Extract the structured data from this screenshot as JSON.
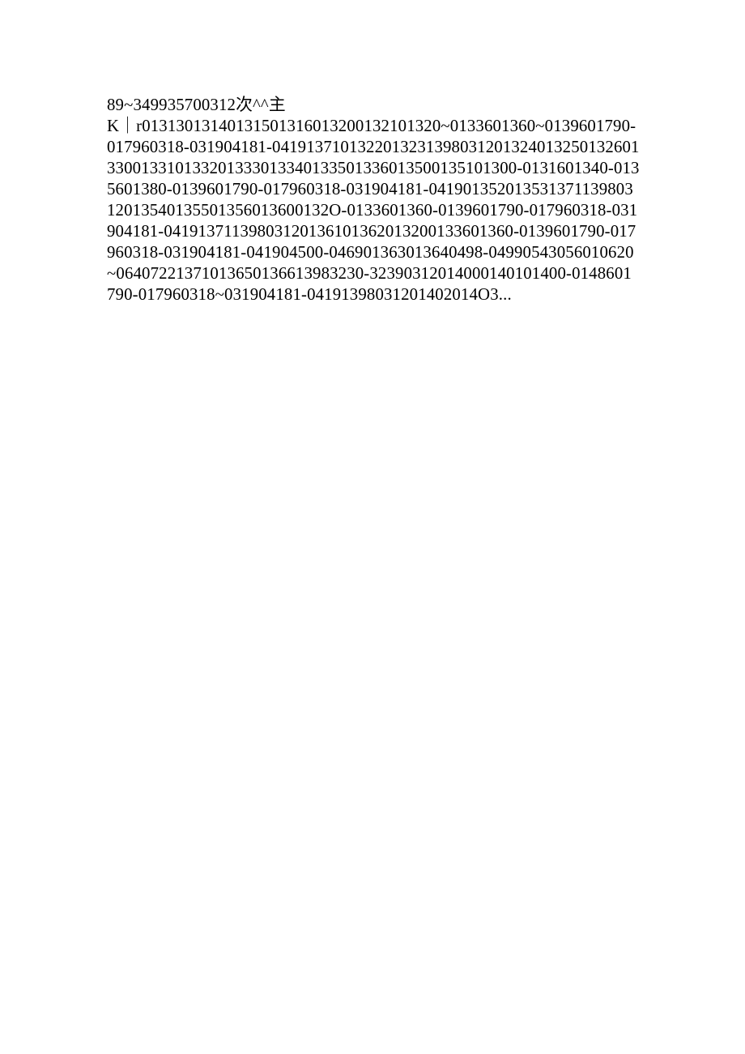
{
  "body_text": "89~349935700312次^^主\nK｜r01313013140131501316013200132101320~0133601360~0139601790-017960318-031904181-0419137101322013231398031201324013250132601330013310133201333013340133501336013500135101300-0131601340-0135601380-0139601790-017960318-031904181-04190135201353137113980312013540135501356013600132O-0133601360-0139601790-017960318-031904181-04191371139803120136101362013200133601360-0139601790-017960318-031904181-041904500-046901363013640498-04990543056010620~06407221371013650136613983230-32390312014000140101400-0148601790-017960318~031904181-04191398031201402014O3..."
}
